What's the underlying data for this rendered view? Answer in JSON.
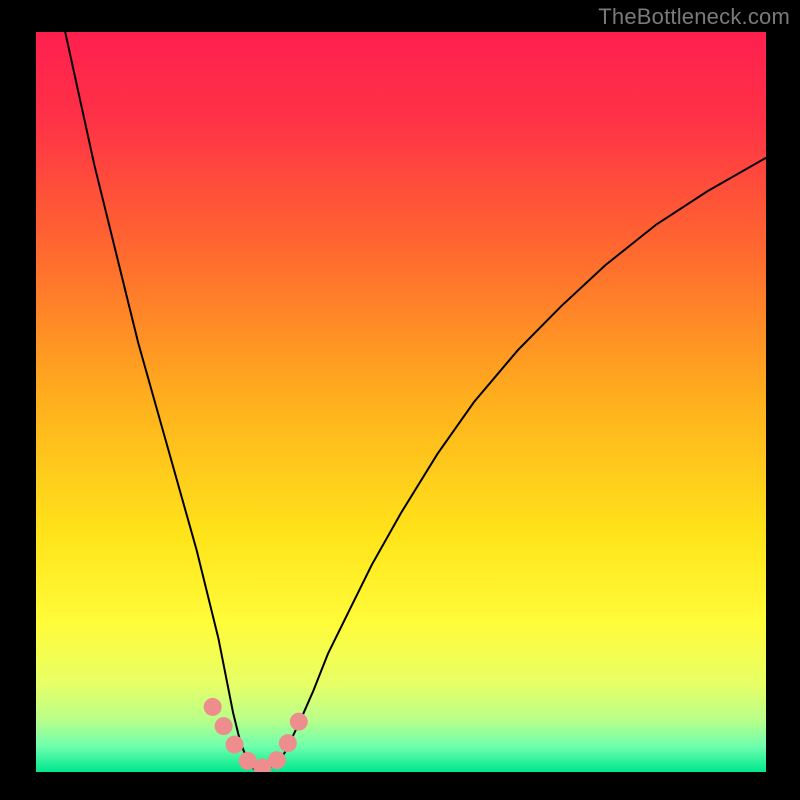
{
  "watermark": "TheBottleneck.com",
  "chart_data": {
    "type": "line",
    "title": "",
    "xlabel": "",
    "ylabel": "",
    "xlim": [
      0,
      100
    ],
    "ylim": [
      0,
      100
    ],
    "grid": false,
    "legend": false,
    "background_gradient_stops": [
      {
        "offset": 0.0,
        "color": "#ff1f4f"
      },
      {
        "offset": 0.12,
        "color": "#ff3246"
      },
      {
        "offset": 0.3,
        "color": "#ff6a2f"
      },
      {
        "offset": 0.5,
        "color": "#ffb01d"
      },
      {
        "offset": 0.68,
        "color": "#ffe41a"
      },
      {
        "offset": 0.8,
        "color": "#fffc3a"
      },
      {
        "offset": 0.88,
        "color": "#e8ff66"
      },
      {
        "offset": 0.93,
        "color": "#b8ff8a"
      },
      {
        "offset": 0.965,
        "color": "#6fffad"
      },
      {
        "offset": 1.0,
        "color": "#00e88f"
      }
    ],
    "series": [
      {
        "name": "bottleneck-curve",
        "color": "#000000",
        "stroke_width": 2,
        "x": [
          4,
          6,
          8,
          10,
          12,
          14,
          16,
          18,
          20,
          22,
          23.5,
          25,
          26,
          27,
          28,
          29,
          30,
          31,
          32,
          34,
          36,
          38,
          40,
          43,
          46,
          50,
          55,
          60,
          66,
          72,
          78,
          85,
          92,
          100
        ],
        "y": [
          100,
          91,
          82,
          74,
          66,
          58,
          51,
          44,
          37,
          30,
          24,
          18,
          13,
          8,
          4,
          1.5,
          0.2,
          0,
          0.5,
          2.5,
          6.5,
          11,
          16,
          22,
          28,
          35,
          43,
          50,
          57,
          63,
          68.5,
          74,
          78.5,
          83
        ]
      }
    ],
    "markers": {
      "name": "bottleneck-dots",
      "color": "#ee8d8d",
      "radius": 9,
      "points": [
        {
          "x": 24.2,
          "y": 8.8
        },
        {
          "x": 25.7,
          "y": 6.2
        },
        {
          "x": 27.2,
          "y": 3.7
        },
        {
          "x": 29.0,
          "y": 1.5
        },
        {
          "x": 31.0,
          "y": 0.6
        },
        {
          "x": 33.0,
          "y": 1.6
        },
        {
          "x": 34.5,
          "y": 3.9
        },
        {
          "x": 36.0,
          "y": 6.8
        }
      ]
    }
  }
}
